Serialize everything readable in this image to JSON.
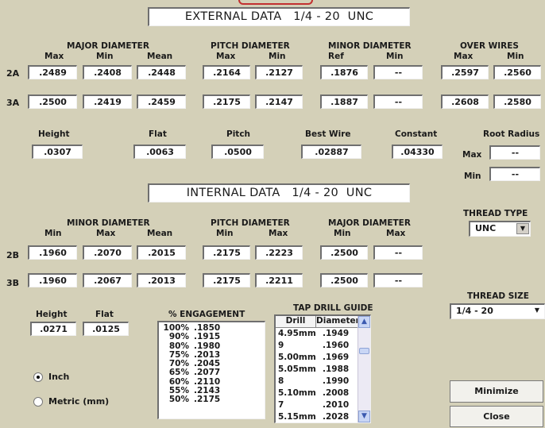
{
  "external": {
    "title": "EXTERNAL DATA   1/4 - 20  UNC",
    "groups": {
      "major": "MAJOR DIAMETER",
      "pitch": "PITCH DIAMETER",
      "minor": "MINOR DIAMETER",
      "wires": "OVER WIRES"
    },
    "sub": {
      "major": [
        "Max",
        "Min",
        "Mean"
      ],
      "pitch": [
        "Max",
        "Min"
      ],
      "minor": [
        "Ref",
        "Min"
      ],
      "wires": [
        "Max",
        "Min"
      ]
    },
    "rows": [
      {
        "label": "2A",
        "values": [
          ".2489",
          ".2408",
          ".2448",
          ".2164",
          ".2127",
          ".1876",
          "--",
          ".2597",
          ".2560"
        ]
      },
      {
        "label": "3A",
        "values": [
          ".2500",
          ".2419",
          ".2459",
          ".2175",
          ".2147",
          ".1887",
          "--",
          ".2608",
          ".2580"
        ]
      }
    ],
    "params": {
      "height_label": "Height",
      "height": ".0307",
      "flat_label": "Flat",
      "flat": ".0063",
      "pitch_label": "Pitch",
      "pitch": ".0500",
      "bestwire_label": "Best Wire",
      "bestwire": ".02887",
      "constant_label": "Constant",
      "constant": ".04330"
    },
    "root_radius": {
      "label": "Root Radius",
      "max_label": "Max",
      "max": "--",
      "min_label": "Min",
      "min": "--"
    }
  },
  "internal": {
    "title": "INTERNAL DATA   1/4 - 20  UNC",
    "groups": {
      "minor": "MINOR DIAMETER",
      "pitch": "PITCH DIAMETER",
      "major": "MAJOR DIAMETER"
    },
    "sub": {
      "minor": [
        "Min",
        "Max",
        "Mean"
      ],
      "pitch": [
        "Min",
        "Max"
      ],
      "major": [
        "Min",
        "Max"
      ]
    },
    "rows": [
      {
        "label": "2B",
        "values": [
          ".1960",
          ".2070",
          ".2015",
          ".2175",
          ".2223",
          ".2500",
          "--"
        ]
      },
      {
        "label": "3B",
        "values": [
          ".1960",
          ".2067",
          ".2013",
          ".2175",
          ".2211",
          ".2500",
          "--"
        ]
      }
    ],
    "params": {
      "height_label": "Height",
      "height": ".0271",
      "flat_label": "Flat",
      "flat": ".0125"
    }
  },
  "thread_type": {
    "label": "THREAD TYPE",
    "value": "UNC"
  },
  "thread_size": {
    "label": "THREAD SIZE",
    "value": "1/4 - 20"
  },
  "engagement": {
    "label": "% ENGAGEMENT",
    "rows": [
      [
        "100%",
        ".1850"
      ],
      [
        "90%",
        ".1915"
      ],
      [
        "80%",
        ".1980"
      ],
      [
        "75%",
        ".2013"
      ],
      [
        "70%",
        ".2045"
      ],
      [
        "65%",
        ".2077"
      ],
      [
        "60%",
        ".2110"
      ],
      [
        "55%",
        ".2143"
      ],
      [
        "50%",
        ".2175"
      ]
    ]
  },
  "tap_drill": {
    "label": "TAP DRILL GUIDE",
    "columns": [
      "Drill",
      "Diameter"
    ],
    "rows": [
      [
        "4.95mm",
        ".1949"
      ],
      [
        "9",
        ".1960"
      ],
      [
        "5.00mm",
        ".1969"
      ],
      [
        "5.05mm",
        ".1988"
      ],
      [
        "8",
        ".1990"
      ],
      [
        "5.10mm",
        ".2008"
      ],
      [
        "7",
        ".2010"
      ],
      [
        "5.15mm",
        ".2028"
      ]
    ]
  },
  "units": {
    "inch": "Inch",
    "metric": "Metric (mm)",
    "selected": "inch"
  },
  "buttons": {
    "minimize": "Minimize",
    "close": "Close"
  }
}
